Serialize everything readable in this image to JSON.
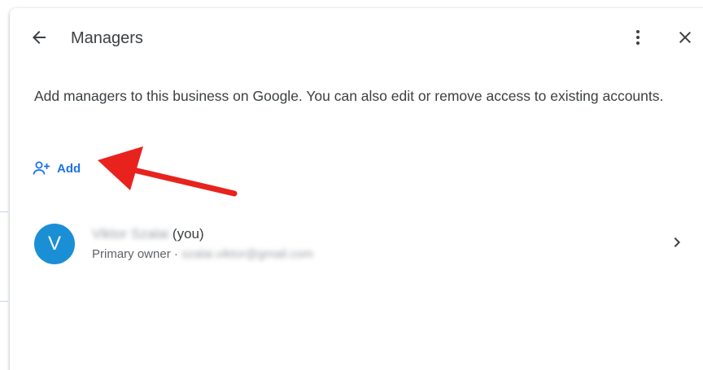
{
  "header": {
    "title": "Managers",
    "back_icon": "arrow-left-icon",
    "more_icon": "more-vert-icon",
    "close_icon": "close-icon"
  },
  "description": "Add managers to this business on Google. You can also edit or remove access to existing accounts.",
  "add_button": {
    "label": "Add",
    "icon": "person-add-icon"
  },
  "account": {
    "avatar_initial": "V",
    "name_blurred": "Viktor Szalai",
    "name_suffix": "(you)",
    "role": "Primary owner",
    "email_blurred": "szalai.viktor@gmail.com",
    "chevron_icon": "chevron-right-icon"
  },
  "colors": {
    "accent": "#1a73e8",
    "avatar": "#1a8fd6",
    "annotation_arrow": "#e8231d",
    "text_primary": "#3c4043",
    "text_secondary": "#5f6368"
  }
}
